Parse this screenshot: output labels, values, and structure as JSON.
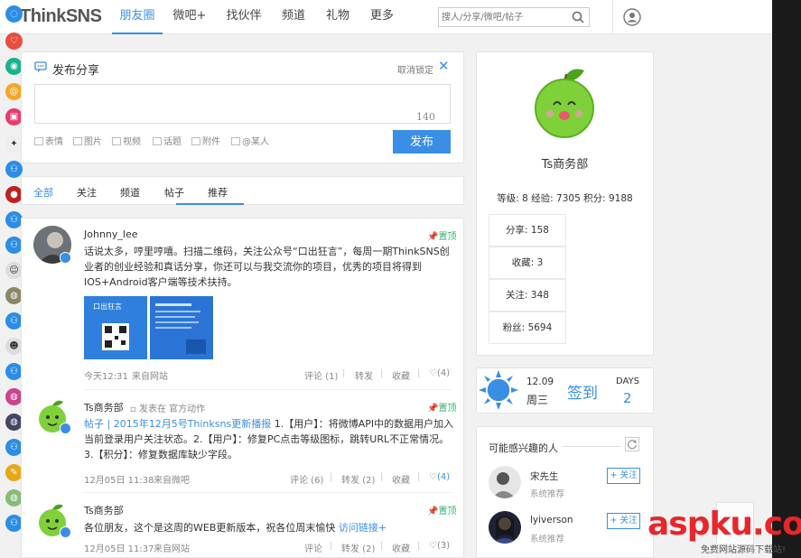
{
  "header": {
    "logo": "ThinkSNS",
    "nav": [
      "朋友圈",
      "微吧+",
      "找伙伴",
      "频道",
      "礼物",
      "更多"
    ],
    "search_placeholder": "搜人/分享/微吧/帖子"
  },
  "publish": {
    "title": "发布分享",
    "unlock": "取消锁定",
    "counter": "140",
    "tools": [
      "表情",
      "图片",
      "视频",
      "话题",
      "附件",
      "@某人"
    ],
    "button": "发布"
  },
  "tabs": [
    "全部",
    "关注",
    "频道",
    "帖子",
    "推荐"
  ],
  "feed": [
    {
      "user": "Johnny_lee",
      "pin": "置顶",
      "text": "话说太多，哼里哼嘻。扫描二维码，关注公众号“口出狂言”，每周一期ThinkSNS创业者的创业经验和真话分享，你还可以与我交流你的项目，优秀的项目将得到IOS+Android客户端等技术扶持。",
      "time": "今天12:31",
      "source": "来自网站",
      "comment": "评论 (1)",
      "repost": "转发",
      "fav": "收藏",
      "like": "(4)"
    },
    {
      "user": "Ts商务部",
      "posted_in": "发表在 官方动作",
      "pin": "置顶",
      "link": "帖子 | 2015年12月5号Thinksns更新播报",
      "text": " 1.【用户】：将微博API中的数据用户加入当前登录用户关注状态。2.【用户】：修复PC点击等级图标，跳转URL不正常情况。3.【积分】：修复数据库缺少字段。",
      "time": "12月05日 11:38",
      "source": "来自微吧",
      "comment": "评论 (6)",
      "repost": "转发 (2)",
      "fav": "收藏",
      "like": "(4)"
    },
    {
      "user": "Ts商务部",
      "pin": "置顶",
      "text": "各位朋友，这个是这周的WEB更新版本，祝各位周末愉快 ",
      "link": "访问链接+",
      "time": "12月05日 11:37",
      "source": "来自网站",
      "comment": "评论",
      "repost": "转发 (2)",
      "fav": "收藏",
      "like": "(3)"
    }
  ],
  "profile": {
    "name": "Ts商务部",
    "stats": "等级: 8  经验: 7305  积分: 9188",
    "boxes": [
      "分享: 158",
      "收藏: 3",
      "关注: 348",
      "粉丝: 5694"
    ]
  },
  "sign": {
    "date": "12.09",
    "week": "周三",
    "button": "签到",
    "days_label": "DAYS",
    "days": "2"
  },
  "recommend": {
    "title": "可能感兴趣的人",
    "people": [
      {
        "name": "宋先生",
        "sub": "系统推荐",
        "btn": "+ 关注"
      },
      {
        "name": "lyiverson",
        "sub": "系统推荐",
        "btn": "+ 关注"
      }
    ]
  },
  "watermark": {
    "main": "aspku.com",
    "sub": "免费网站源码下载站!"
  },
  "colors": {
    "accent": "#3a8ee6",
    "pin": "#2db36c",
    "header_bg": "#ffffff"
  }
}
